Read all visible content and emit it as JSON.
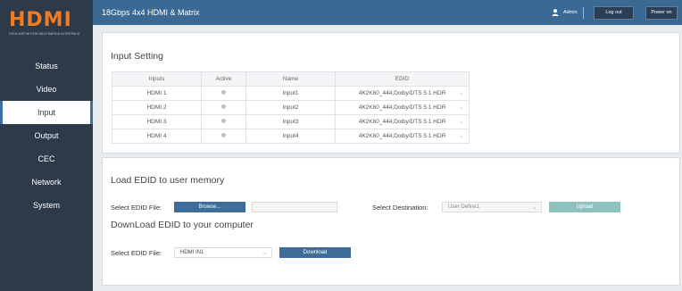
{
  "brand": {
    "logo_text": "HDMI",
    "tagline": "HIGH-DEFINITION MULTIMEDIA INTERFACE"
  },
  "header": {
    "title": "18Gbps 4x4 HDMI & Matrix",
    "user": "Admin",
    "logout_label": "Log out",
    "poweron_label": "Power on"
  },
  "sidebar": {
    "items": [
      {
        "label": "Status"
      },
      {
        "label": "Video"
      },
      {
        "label": "Input"
      },
      {
        "label": "Output"
      },
      {
        "label": "CEC"
      },
      {
        "label": "Network"
      },
      {
        "label": "System"
      }
    ]
  },
  "input_setting": {
    "title": "Input Setting",
    "columns": [
      "Inputs",
      "Active",
      "Name",
      "EDID"
    ],
    "rows": [
      {
        "input": "HDMI 1",
        "name": "Input1",
        "edid": "4K2K60_444,Dolby/DTS 5.1 HDR"
      },
      {
        "input": "HDMI 2",
        "name": "Input2",
        "edid": "4K2K60_444,Dolby/DTS 5.1 HDR"
      },
      {
        "input": "HDMI 3",
        "name": "Input3",
        "edid": "4K2K60_444,Dolby/DTS 5.1 HDR"
      },
      {
        "input": "HDMI 4",
        "name": "Input4",
        "edid": "4K2K60_444,Dolby/DTS 5.1 HDR"
      }
    ]
  },
  "load_edid": {
    "title": "Load EDID to user memory",
    "select_file_label": "Select EDID File:",
    "browse_label": "Browse...",
    "select_destination_label": "Select Destination:",
    "destination_value": "User Define1",
    "upload_label": "Upload"
  },
  "download_edid": {
    "title": "DownLoad EDID to your computer",
    "select_file_label": "Select EDID File:",
    "file_value": "HDMI IN1",
    "download_label": "Download"
  },
  "colors": {
    "sidebar": "#2c3a4a",
    "topbar": "#3a6a94",
    "accent": "#3d6e99",
    "logo": "#f47a1f",
    "upload_disabled": "#8fc1bd"
  }
}
